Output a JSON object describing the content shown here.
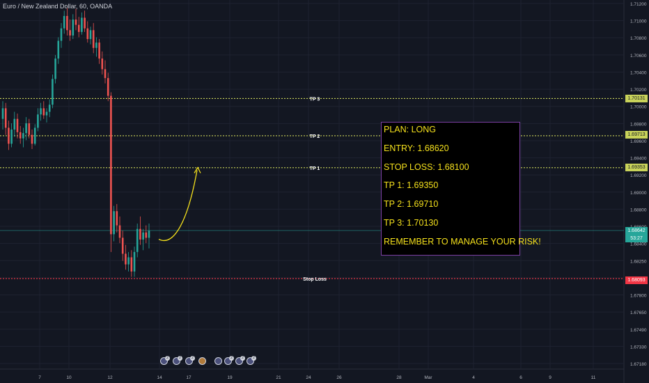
{
  "chart_data": {
    "type": "candlestick",
    "title": "Euro / New Zealand Dollar, 60, OANDA",
    "ylim": [
      1.6708,
      1.7124
    ],
    "y_ticks": [
      "1.71200",
      "1.71000",
      "1.70800",
      "1.70600",
      "1.70400",
      "1.70200",
      "1.70000",
      "1.69800",
      "1.69600",
      "1.69400",
      "1.69200",
      "1.69000",
      "1.68800",
      "1.68600",
      "1.68400",
      "1.68250",
      "1.67950",
      "1.67800",
      "1.67650",
      "1.67490",
      "1.67330",
      "1.67180"
    ],
    "x_ticks": [
      "7",
      "10",
      "12",
      "14",
      "17",
      "19",
      "21",
      "24",
      "26",
      "28",
      "Mar",
      "4",
      "6",
      "9",
      "11"
    ],
    "levels": [
      {
        "name": "TP 3",
        "price": 1.7013,
        "tag": "1.70131",
        "color": "#c9d35a"
      },
      {
        "name": "TP 2",
        "price": 1.6971,
        "tag": "1.69713",
        "color": "#c9d35a"
      },
      {
        "name": "TP 1",
        "price": 1.6935,
        "tag": "1.69353",
        "color": "#c9d35a"
      },
      {
        "name": "Stop Loss",
        "price": 1.681,
        "tag": "1.68093",
        "color": "#f23645"
      }
    ],
    "current_price": {
      "price": 1.68642,
      "tag": "1.68642",
      "countdown": "53:27",
      "color": "#26a69a"
    },
    "candles_ohlc": [
      [
        1.699,
        1.701,
        1.6978,
        1.7002
      ],
      [
        1.7002,
        1.7008,
        1.6972,
        1.698
      ],
      [
        1.698,
        1.6988,
        1.6955,
        1.6962
      ],
      [
        1.6962,
        1.6985,
        1.6958,
        1.6978
      ],
      [
        1.6978,
        1.6998,
        1.697,
        1.699
      ],
      [
        1.699,
        1.6996,
        1.6968,
        1.6975
      ],
      [
        1.6975,
        1.6982,
        1.6962,
        1.6968
      ],
      [
        1.6968,
        1.698,
        1.6958,
        1.6974
      ],
      [
        1.6974,
        1.6992,
        1.6966,
        1.6985
      ],
      [
        1.6985,
        1.699,
        1.6968,
        1.6972
      ],
      [
        1.6972,
        1.6978,
        1.6956,
        1.6962
      ],
      [
        1.6962,
        1.6984,
        1.696,
        1.698
      ],
      [
        1.698,
        1.7002,
        1.6976,
        1.6995
      ],
      [
        1.6995,
        1.7008,
        1.6988,
        1.7002
      ],
      [
        1.7002,
        1.701,
        1.699,
        1.6994
      ],
      [
        1.6994,
        1.7002,
        1.6986,
        1.6998
      ],
      [
        1.6998,
        1.7012,
        1.6992,
        1.7006
      ],
      [
        1.7006,
        1.704,
        1.7002,
        1.7035
      ],
      [
        1.7035,
        1.7062,
        1.703,
        1.7058
      ],
      [
        1.7058,
        1.7082,
        1.7052,
        1.7078
      ],
      [
        1.7078,
        1.7098,
        1.707,
        1.7092
      ],
      [
        1.7092,
        1.7112,
        1.7086,
        1.7106
      ],
      [
        1.7106,
        1.7115,
        1.7084,
        1.709
      ],
      [
        1.709,
        1.7102,
        1.7078,
        1.7084
      ],
      [
        1.7084,
        1.7108,
        1.708,
        1.7102
      ],
      [
        1.7102,
        1.7114,
        1.709,
        1.7096
      ],
      [
        1.7096,
        1.7105,
        1.7082,
        1.7088
      ],
      [
        1.7088,
        1.711,
        1.7085,
        1.7104
      ],
      [
        1.7104,
        1.7112,
        1.7088,
        1.7092
      ],
      [
        1.7092,
        1.71,
        1.7076,
        1.708
      ],
      [
        1.708,
        1.7094,
        1.7074,
        1.709
      ],
      [
        1.709,
        1.7098,
        1.7064,
        1.707
      ],
      [
        1.707,
        1.7082,
        1.706,
        1.7076
      ],
      [
        1.7076,
        1.708,
        1.7052,
        1.7058
      ],
      [
        1.7058,
        1.7066,
        1.704,
        1.7046
      ],
      [
        1.7046,
        1.7056,
        1.703,
        1.7036
      ],
      [
        1.7036,
        1.7042,
        1.701,
        1.7016
      ],
      [
        1.7016,
        1.702,
        1.684,
        1.686
      ],
      [
        1.686,
        1.6892,
        1.6852,
        1.6886
      ],
      [
        1.6886,
        1.6894,
        1.6862,
        1.687
      ],
      [
        1.687,
        1.688,
        1.685,
        1.6856
      ],
      [
        1.6856,
        1.6864,
        1.683,
        1.6838
      ],
      [
        1.6838,
        1.6848,
        1.682,
        1.6826
      ],
      [
        1.6826,
        1.684,
        1.6818,
        1.6834
      ],
      [
        1.6834,
        1.6842,
        1.6812,
        1.6818
      ],
      [
        1.6818,
        1.6846,
        1.6812,
        1.684
      ],
      [
        1.684,
        1.6872,
        1.6834,
        1.6866
      ],
      [
        1.6866,
        1.688,
        1.6848,
        1.6854
      ],
      [
        1.6854,
        1.6866,
        1.6842,
        1.6862
      ],
      [
        1.6862,
        1.687,
        1.685,
        1.6856
      ],
      [
        1.6856,
        1.6872,
        1.6844,
        1.6864
      ]
    ],
    "annotation": "arrow projection from 1.6852 toward TP 1"
  },
  "plan_box": {
    "lines": [
      "PLAN: LONG",
      "ENTRY: 1.68620",
      "STOP LOSS: 1.68100",
      "TP 1: 1.69350",
      "TP 2: 1.69710",
      "TP 3: 1.70130",
      "REMEMBER TO MANAGE YOUR RISK!"
    ],
    "text_color": "#f5e11c",
    "border_color": "#7b3fa3"
  },
  "events": [
    {
      "icon": "flag-event-icon",
      "badge": "2"
    },
    {
      "icon": "flag-event-icon",
      "badge": "2"
    },
    {
      "icon": "flag-event-icon",
      "badge": "2"
    },
    {
      "icon": "calendar-event-icon",
      "badge": ""
    },
    {
      "icon": "flag-event-icon",
      "badge": ""
    },
    {
      "icon": "flag-event-icon",
      "badge": "2"
    },
    {
      "icon": "flag-event-icon",
      "badge": "2"
    },
    {
      "icon": "flag-event-icon",
      "badge": "2"
    }
  ],
  "colors": {
    "background": "#131722",
    "grid": "#1e2230",
    "up": "#26a69a",
    "down": "#ef5350",
    "axis_text": "#b2b5be",
    "arrow": "#f5e11c"
  }
}
